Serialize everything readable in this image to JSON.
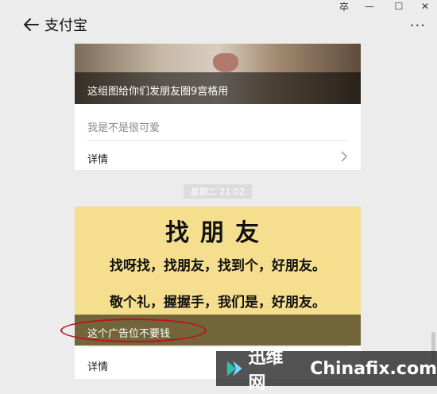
{
  "window_controls": {
    "pin": "卒",
    "minimize": "—",
    "maximize": "☐",
    "close": "✕"
  },
  "header": {
    "title": "支付宝",
    "more": "···"
  },
  "card1": {
    "caption": "这组图给你们发朋友圈9宫格用",
    "subtitle": "我是不是很可爱",
    "detail_label": "详情"
  },
  "timestamp": "星期二 21:02",
  "card2": {
    "headline": "找朋友",
    "line1": "找呀找，找朋友，找到个，好朋友。",
    "line2": "敬个礼，握握手，我们是，好朋友。",
    "caption": "这个广告位不要钱",
    "detail_label": "详情"
  },
  "watermark": {
    "cn": "迅维网",
    "en": "Chinafix.com"
  },
  "colors": {
    "background": "#ececec",
    "card": "#ffffff",
    "poster_yellow": "#f5df8f",
    "annotation_red": "#c0101b"
  }
}
